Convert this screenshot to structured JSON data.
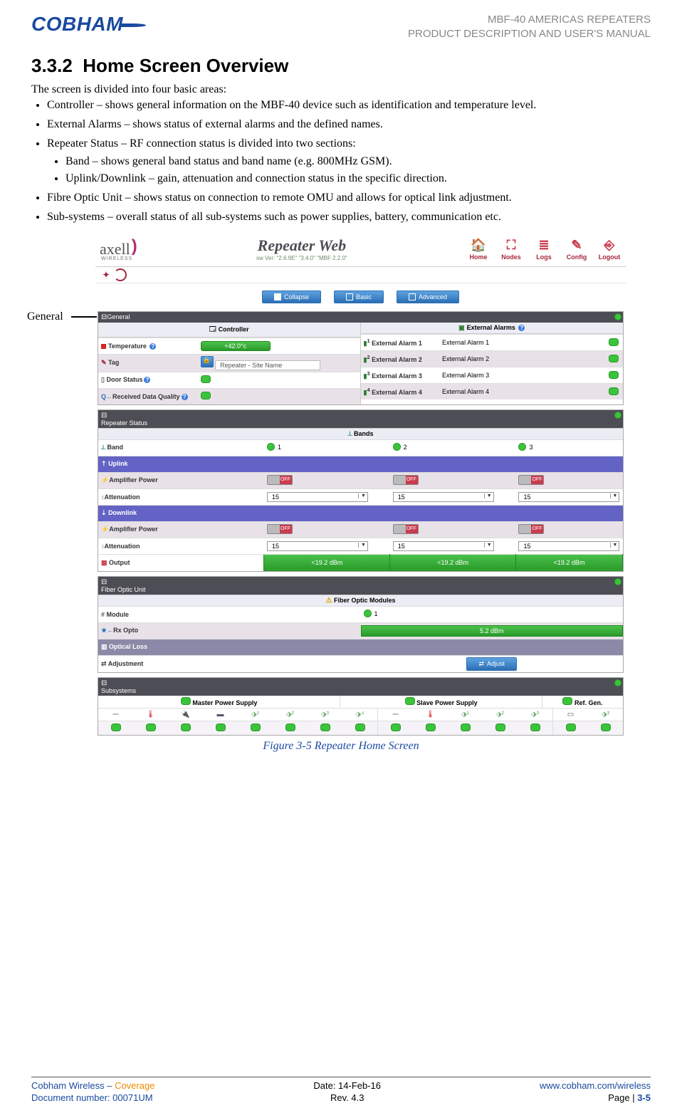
{
  "header": {
    "logo_text": "COBHAM",
    "doc_line1": "MBF-40 AMERICAS REPEATERS",
    "doc_line2": "PRODUCT DESCRIPTION AND USER'S MANUAL"
  },
  "section": {
    "number": "3.3.2",
    "title": "Home Screen Overview",
    "intro": "The screen is divided into four basic areas:",
    "bullets": [
      "Controller – shows general information on the MBF-40 device such as identification and temperature level.",
      "External Alarms – shows status of external alarms and the defined names.",
      "Repeater Status – RF connection status is divided into two sections:",
      "Fibre Optic Unit – shows status on connection to remote OMU and allows for optical link adjustment.",
      "Sub-systems – overall status of all sub-systems such as power supplies, battery, communication etc."
    ],
    "sub_bullets": [
      "Band – shows general band status and band name (e.g. 800MHz GSM).",
      "Uplink/Downlink – gain, attenuation and connection status in the specific direction."
    ],
    "callout": "General",
    "figure_caption": "Figure 3-5 Repeater Home Screen"
  },
  "screenshot": {
    "brand": "axell",
    "brand_sub": "WIRELESS",
    "center_title": "Repeater Web",
    "center_sub": "sw Ver: \"2.6.9E\" \"3.4.0\" \"MBF 2.2.0\"",
    "nav": [
      {
        "icon": "🏠",
        "label": "Home"
      },
      {
        "icon": "⛶",
        "label": "Nodes"
      },
      {
        "icon": "≣",
        "label": "Logs"
      },
      {
        "icon": "✎",
        "label": "Config"
      },
      {
        "icon": "⎆",
        "label": "Logout"
      }
    ],
    "refresh": "C",
    "buttons": {
      "collapse": "Collapse",
      "basic": "Basic",
      "advanced": "Advanced"
    },
    "general_title": "General",
    "controller_title": "Controller",
    "ext_alarms_title": "External Alarms",
    "controller": {
      "temperature_label": "Temperature",
      "temperature_value": "+42.0°c",
      "tag_label": "Tag",
      "tag_value": "Repeater - Site Name",
      "door_label": "Door Status",
      "rdq_label": "Received Data Quality"
    },
    "ext_alarms": [
      {
        "k": "External Alarm 1",
        "v": "External Alarm 1"
      },
      {
        "k": "External Alarm 2",
        "v": "External Alarm 2"
      },
      {
        "k": "External Alarm 3",
        "v": "External Alarm 3"
      },
      {
        "k": "External Alarm 4",
        "v": "External Alarm 4"
      }
    ],
    "repeater_status_title": "Repeater Status",
    "bands_title": "Bands",
    "band_label": "Band",
    "bands": [
      "1",
      "2",
      "3"
    ],
    "uplink": "Uplink",
    "downlink": "Downlink",
    "amp_power": "Amplifier Power",
    "attenuation": "Attenuation",
    "output": "Output",
    "switch_off": "OFF",
    "atten_value": "15",
    "output_value": "<19.2 dBm",
    "fou_title": "Fiber Optic Unit",
    "fom_title": "Fiber Optic Modules",
    "module_label": "Module",
    "module_1": "1",
    "rx_opto": "Rx Opto",
    "rx_opto_val": "5.2 dBm",
    "optical_loss": "Optical Loss",
    "adjustment": "Adjustment",
    "adjust_btn": "Adjust",
    "subsys_title": "Subsystems",
    "subsys_headers": {
      "master": "Master Power Supply",
      "slave": "Slave Power Supply",
      "ref": "Ref. Gen."
    }
  },
  "footer": {
    "l1a": "Cobham Wireless",
    "l1b": "Coverage",
    "l2": "Document number: 00071UM",
    "c1": "Date: 14-Feb-16",
    "c2": "Rev. 4.3",
    "r1": "www.cobham.com/wireless",
    "r2a": "Page | ",
    "r2b": "3-5"
  }
}
